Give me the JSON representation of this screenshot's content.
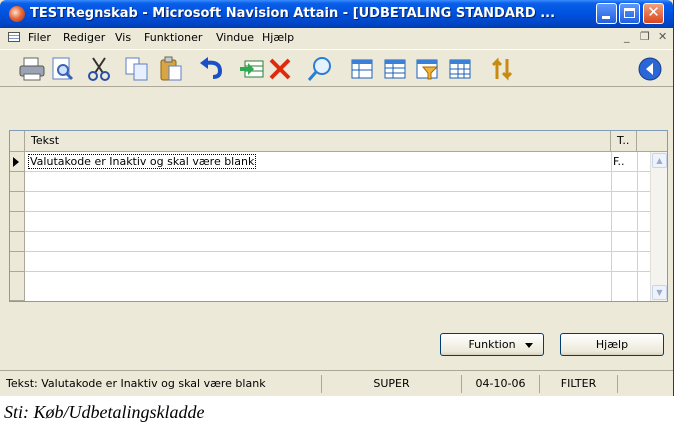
{
  "window": {
    "title": "TESTRegnskab - Microsoft Navision Attain - [UDBETALING STANDARD ...",
    "title_bar_color": "#0054e3"
  },
  "menu": {
    "items": [
      "Filer",
      "Rediger",
      "Vis",
      "Funktioner",
      "Vindue",
      "Hjælp"
    ]
  },
  "toolbar": {
    "icons": [
      "print-icon",
      "print-preview-icon",
      "cut-icon",
      "copy-icon",
      "paste-icon",
      "undo-icon",
      "insert-record-icon",
      "delete-icon",
      "find-icon",
      "form-view-icon",
      "list-view-icon",
      "table-filter-icon",
      "show-all-icon",
      "sort-icon",
      "help-icon"
    ]
  },
  "grid": {
    "columns": [
      "Tekst",
      "T.."
    ],
    "rows": [
      {
        "tekst": "Valutakode er Inaktiv og skal være blank",
        "t": "F.."
      }
    ]
  },
  "buttons": {
    "funktion": "Funktion",
    "hjaelp": "Hjælp"
  },
  "statusbar": {
    "field": "Tekst: Valutakode er Inaktiv og skal være blank",
    "user": "SUPER",
    "date": "04-10-06",
    "filter": "FILTER"
  },
  "caption": "Sti: Køb/Udbetalingskladde"
}
